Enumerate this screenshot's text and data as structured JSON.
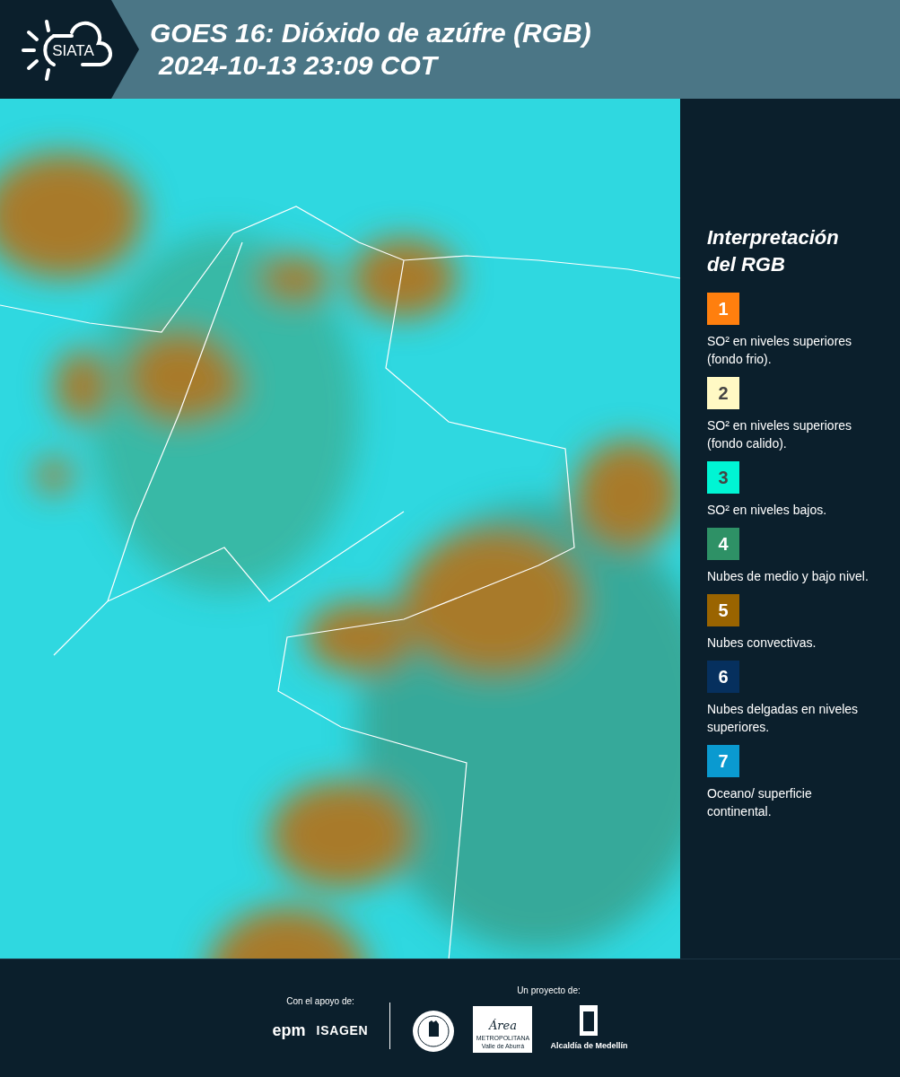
{
  "header": {
    "logo_text": "SIATA",
    "title": "GOES 16: Dióxido de azúfre (RGB)",
    "timestamp": "2024-10-13 23:09 COT"
  },
  "legend": {
    "title": "Interpretación del RGB",
    "items": [
      {
        "number": "1",
        "color": "#ff7f0e",
        "description": "SO² en niveles superiores (fondo frio)."
      },
      {
        "number": "2",
        "color": "#fff9c4",
        "description": "SO² en niveles superiores (fondo calido)."
      },
      {
        "number": "3",
        "color": "#00f5d4",
        "description": "SO² en niveles bajos."
      },
      {
        "number": "4",
        "color": "#2e9166",
        "description": "Nubes de medio y bajo nivel."
      },
      {
        "number": "5",
        "color": "#9a6400",
        "description": "Nubes convectivas."
      },
      {
        "number": "6",
        "color": "#06305e",
        "description": "Nubes delgadas en niveles superiores."
      },
      {
        "number": "7",
        "color": "#0a9ad0",
        "description": "Oceano/ superficie continental."
      }
    ]
  },
  "footer": {
    "support_label": "Con el apoyo de:",
    "project_label": "Un proyecto de:",
    "sponsors": [
      "epm",
      "ISAGEN"
    ],
    "partners": [
      {
        "kind": "seal"
      },
      {
        "kind": "area",
        "lines": [
          "Área",
          "METROPOLITANA",
          "Valle de Aburrá"
        ]
      },
      {
        "kind": "alcaldia",
        "lines": [
          "Alcaldía de Medellín"
        ]
      }
    ]
  }
}
